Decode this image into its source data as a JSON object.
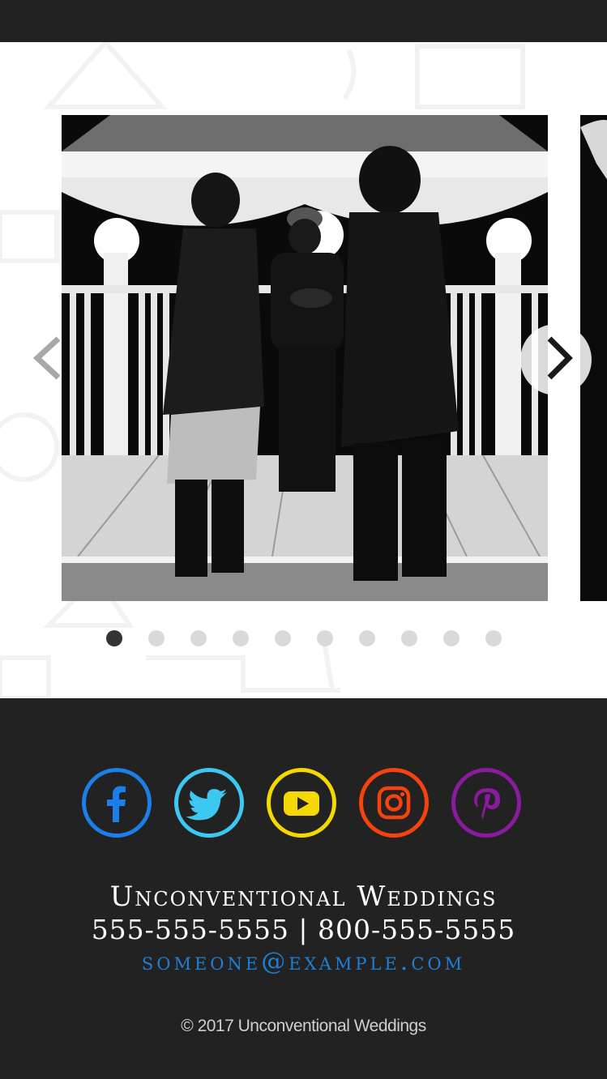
{
  "carousel": {
    "slide_alt": "Wedding ceremony photo",
    "slide_count": 10,
    "active_index": 0,
    "prev_icon": "chevron-left-icon",
    "next_icon": "chevron-right-icon"
  },
  "social": [
    {
      "name": "facebook",
      "icon": "facebook-icon",
      "color": "#1a7fe8"
    },
    {
      "name": "twitter",
      "icon": "twitter-icon",
      "color": "#3cc8f0"
    },
    {
      "name": "youtube",
      "icon": "youtube-icon",
      "color": "#f5d800"
    },
    {
      "name": "instagram",
      "icon": "instagram-icon",
      "color": "#f5430f"
    },
    {
      "name": "pinterest",
      "icon": "pinterest-icon",
      "color": "#8a1a9e"
    }
  ],
  "footer": {
    "brand": "Unconventional Weddings",
    "phones": "555-555-5555 | 800-555-5555",
    "email": "someone@example.com",
    "copyright": "© 2017 Unconventional Weddings"
  }
}
